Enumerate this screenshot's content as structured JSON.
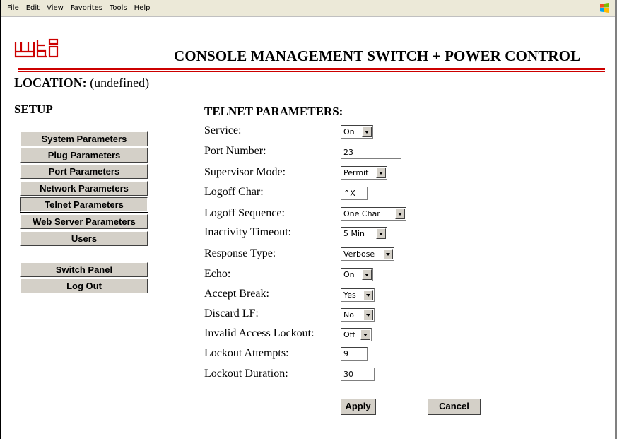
{
  "menubar": {
    "items": [
      "File",
      "Edit",
      "View",
      "Favorites",
      "Tools",
      "Help"
    ]
  },
  "header": {
    "logo_text": "wti",
    "title": "CONSOLE MANAGEMENT SWITCH + POWER CONTROL",
    "location_label": "LOCATION:",
    "location_value": "(undefined)"
  },
  "sidebar": {
    "heading": "SETUP",
    "items": [
      {
        "label": "System Parameters"
      },
      {
        "label": "Plug Parameters"
      },
      {
        "label": "Port Parameters"
      },
      {
        "label": "Network Parameters"
      },
      {
        "label": "Telnet Parameters",
        "active": true
      },
      {
        "label": "Web Server Parameters"
      },
      {
        "label": "Users"
      }
    ],
    "extra": [
      {
        "label": "Switch Panel"
      },
      {
        "label": "Log Out"
      }
    ]
  },
  "form": {
    "title": "TELNET PARAMETERS:",
    "fields": [
      {
        "label": "Service:",
        "type": "select",
        "value": "On"
      },
      {
        "label": "Port Number:",
        "type": "text",
        "value": "23"
      },
      {
        "label": "Supervisor Mode:",
        "type": "select",
        "value": "Permit"
      },
      {
        "label": "Logoff Char:",
        "type": "text",
        "value": "^X"
      },
      {
        "label": "Logoff Sequence:",
        "type": "select",
        "value": "One Char"
      },
      {
        "label": "Inactivity Timeout:",
        "type": "select",
        "value": "5 Min"
      },
      {
        "label": "Response Type:",
        "type": "select",
        "value": "Verbose"
      },
      {
        "label": "Echo:",
        "type": "select",
        "value": "On"
      },
      {
        "label": "Accept Break:",
        "type": "select",
        "value": "Yes"
      },
      {
        "label": "Discard LF:",
        "type": "select",
        "value": "No"
      },
      {
        "label": "Invalid Access Lockout:",
        "type": "select",
        "value": "Off"
      },
      {
        "label": "Lockout Attempts:",
        "type": "text",
        "value": "9"
      },
      {
        "label": "Lockout Duration:",
        "type": "text",
        "value": "30"
      }
    ],
    "apply_label": "Apply",
    "cancel_label": "Cancel"
  },
  "colors": {
    "accent_red": "#cc0000",
    "button_face": "#d4d0c8"
  }
}
